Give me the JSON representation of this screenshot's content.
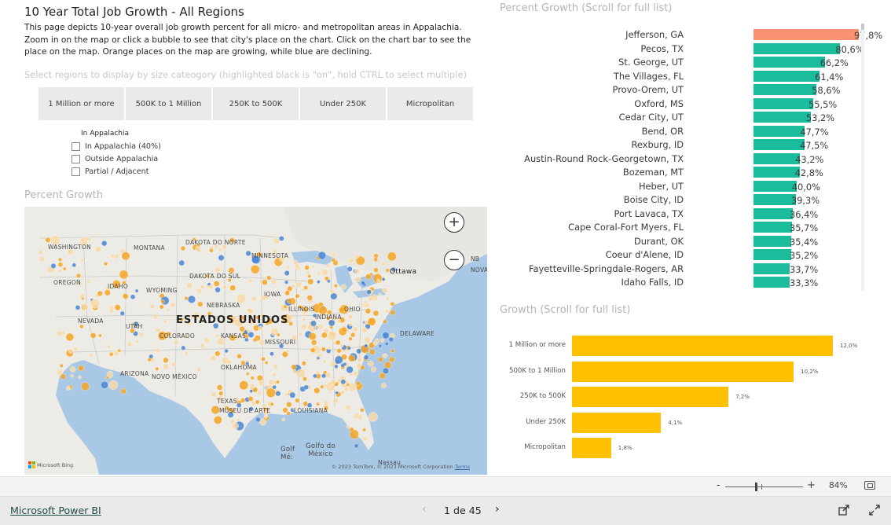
{
  "header": {
    "title": "10 Year Total Job Growth - All Regions",
    "description": "This page depicts 10-year overall job growth percent for all micro- and metropolitan areas in Appalachia. Zoom in on the map or click a bubble to see that city's place on the chart. Click on the chart bar to see the place on the map. Orange places on the map are growing, while blue are declining.",
    "instruction": "Select regions to display by size cateogory (highlighted black is \"on\", hold CTRL to select multiple)"
  },
  "size_slicer": [
    "1 Million or more",
    "500K to 1 Million",
    "250K to 500K",
    "Under 250K",
    "Micropolitan"
  ],
  "appalachia_filter": {
    "title": "In Appalachia",
    "options": [
      "In Appalachia (40%)",
      "Outside Appalachia",
      "Partial / Adjacent"
    ]
  },
  "map": {
    "title": "Percent Growth",
    "country_label": "ESTADOS UNIDOS",
    "labels": [
      "WASHINGTON",
      "MONTANA",
      "DAKOTA DO NORTE",
      "MINNESOTA",
      "OREGON",
      "IDAHO",
      "DAKOTA DO SUL",
      "WYOMING",
      "NEBRASKA",
      "NEVADA",
      "UTAH",
      "COLORADO",
      "KANSAS",
      "MISSOURI",
      "ARIZONA",
      "NOVO MÉXICO",
      "OKLAHOMA",
      "TEXAS",
      "MUSEU DE ARTE",
      "LOUISIANA",
      "IOWA",
      "ILLINOIS",
      "INDIANA",
      "OHIO",
      "DELAWARE",
      "Ottawa",
      "NOVA",
      "NB",
      "Golfo do México",
      "Golf Mé:",
      "Nassau"
    ],
    "credit": "© 2023 TomTom, © 2023 Microsoft Corporation",
    "credit_link": "Terms",
    "logo": "Microsoft Bing",
    "zoom_in": "+",
    "zoom_out": "−",
    "colors": {
      "growing": "#f5a623",
      "declining": "#4a86d4",
      "water": "#a8c8e6",
      "land": "#ecebe6"
    }
  },
  "percent_growth": {
    "title": "Percent Growth  (Scroll for full list)",
    "axis_max": 100,
    "items": [
      {
        "label": "Jefferson, GA",
        "value": 97.8,
        "display": "97,8%",
        "color": "#fa9170"
      },
      {
        "label": "Pecos, TX",
        "value": 80.6,
        "display": "80,6%",
        "color": "#1abc9c"
      },
      {
        "label": "St. George, UT",
        "value": 66.2,
        "display": "66,2%",
        "color": "#1abc9c"
      },
      {
        "label": "The Villages, FL",
        "value": 61.4,
        "display": "61,4%",
        "color": "#1abc9c"
      },
      {
        "label": "Provo-Orem, UT",
        "value": 58.6,
        "display": "58,6%",
        "color": "#1abc9c"
      },
      {
        "label": "Oxford, MS",
        "value": 55.5,
        "display": "55,5%",
        "color": "#1abc9c"
      },
      {
        "label": "Cedar City, UT",
        "value": 53.2,
        "display": "53,2%",
        "color": "#1abc9c"
      },
      {
        "label": "Bend, OR",
        "value": 47.7,
        "display": "47,7%",
        "color": "#1abc9c"
      },
      {
        "label": "Rexburg, ID",
        "value": 47.5,
        "display": "47,5%",
        "color": "#1abc9c"
      },
      {
        "label": "Austin-Round Rock-Georgetown, TX",
        "value": 43.2,
        "display": "43,2%",
        "color": "#1abc9c"
      },
      {
        "label": "Bozeman, MT",
        "value": 42.8,
        "display": "42,8%",
        "color": "#1abc9c"
      },
      {
        "label": "Heber, UT",
        "value": 40.0,
        "display": "40,0%",
        "color": "#1abc9c"
      },
      {
        "label": "Boise City, ID",
        "value": 39.3,
        "display": "39,3%",
        "color": "#1abc9c"
      },
      {
        "label": "Port Lavaca, TX",
        "value": 36.4,
        "display": "36,4%",
        "color": "#1abc9c"
      },
      {
        "label": "Cape Coral-Fort Myers, FL",
        "value": 35.7,
        "display": "35,7%",
        "color": "#1abc9c"
      },
      {
        "label": "Durant, OK",
        "value": 35.4,
        "display": "35,4%",
        "color": "#1abc9c"
      },
      {
        "label": "Coeur d'Alene, ID",
        "value": 35.2,
        "display": "35,2%",
        "color": "#1abc9c"
      },
      {
        "label": "Fayetteville-Springdale-Rogers, AR",
        "value": 33.7,
        "display": "33,7%",
        "color": "#1abc9c"
      },
      {
        "label": "Idaho Falls, ID",
        "value": 33.3,
        "display": "33,3%",
        "color": "#1abc9c"
      }
    ]
  },
  "growth": {
    "title": "Growth (Scroll for full list)",
    "axis_max": 12.0,
    "color": "#ffc000",
    "items": [
      {
        "label": "1 Million or more",
        "value": 12.0,
        "display": "12,0%"
      },
      {
        "label": "500K to 1 Million",
        "value": 10.2,
        "display": "10,2%"
      },
      {
        "label": "250K to 500K",
        "value": 7.2,
        "display": "7,2%"
      },
      {
        "label": "Under 250K",
        "value": 4.1,
        "display": "4,1%"
      },
      {
        "label": "Micropolitan",
        "value": 1.8,
        "display": "1,8%"
      }
    ]
  },
  "chart_data": [
    {
      "type": "bar",
      "title": "Percent Growth  (Scroll for full list)",
      "categories": [
        "Jefferson, GA",
        "Pecos, TX",
        "St. George, UT",
        "The Villages, FL",
        "Provo-Orem, UT",
        "Oxford, MS",
        "Cedar City, UT",
        "Bend, OR",
        "Rexburg, ID",
        "Austin-Round Rock-Georgetown, TX",
        "Bozeman, MT",
        "Heber, UT",
        "Boise City, ID",
        "Port Lavaca, TX",
        "Cape Coral-Fort Myers, FL",
        "Durant, OK",
        "Coeur d'Alene, ID",
        "Fayetteville-Springdale-Rogers, AR",
        "Idaho Falls, ID"
      ],
      "values": [
        97.8,
        80.6,
        66.2,
        61.4,
        58.6,
        55.5,
        53.2,
        47.7,
        47.5,
        43.2,
        42.8,
        40.0,
        39.3,
        36.4,
        35.7,
        35.4,
        35.2,
        33.7,
        33.3
      ],
      "orientation": "horizontal"
    },
    {
      "type": "bar",
      "title": "Growth (Scroll for full list)",
      "categories": [
        "1 Million or more",
        "500K to 1 Million",
        "250K to 500K",
        "Under 250K",
        "Micropolitan"
      ],
      "values": [
        12.0,
        10.2,
        7.2,
        4.1,
        1.8
      ],
      "orientation": "horizontal"
    }
  ],
  "zoom": {
    "minus": "-",
    "plus": "+",
    "level": "84%"
  },
  "footer": {
    "brand": "Microsoft Power BI",
    "page": "1 de 45",
    "prev": "‹",
    "next": "›"
  }
}
